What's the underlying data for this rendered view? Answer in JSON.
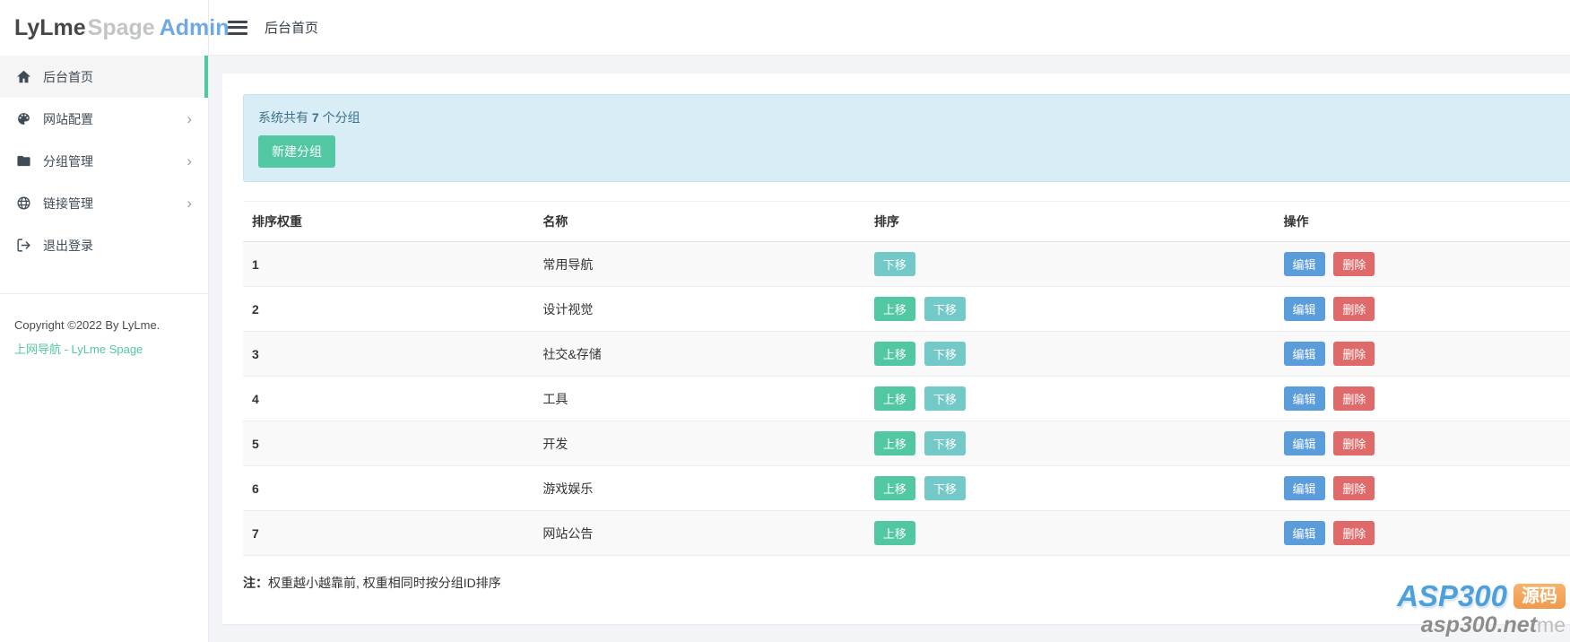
{
  "logo": {
    "part1": "LyLme",
    "part2": "Spage",
    "part3": "Admin"
  },
  "topbar": {
    "title": "后台首页"
  },
  "sidebar": {
    "items": [
      {
        "label": "后台首页"
      },
      {
        "label": "网站配置"
      },
      {
        "label": "分组管理"
      },
      {
        "label": "链接管理"
      },
      {
        "label": "退出登录"
      }
    ],
    "copyright": "Copyright ©2022 By LyLme.",
    "footer_link": "上网导航 - LyLme Spage"
  },
  "alert": {
    "text_prefix": "系统共有 ",
    "count": "7",
    "text_suffix": " 个分组",
    "button_label": "新建分组"
  },
  "table": {
    "headers": [
      "排序权重",
      "名称",
      "排序",
      "操作"
    ],
    "rows": [
      {
        "weight": "1",
        "name": "常用导航",
        "move_up": false,
        "move_down": true
      },
      {
        "weight": "2",
        "name": "设计视觉",
        "move_up": true,
        "move_down": true
      },
      {
        "weight": "3",
        "name": "社交&存储",
        "move_up": true,
        "move_down": true
      },
      {
        "weight": "4",
        "name": "工具",
        "move_up": true,
        "move_down": true
      },
      {
        "weight": "5",
        "name": "开发",
        "move_up": true,
        "move_down": true
      },
      {
        "weight": "6",
        "name": "游戏娱乐",
        "move_up": true,
        "move_down": true
      },
      {
        "weight": "7",
        "name": "网站公告",
        "move_up": true,
        "move_down": false
      }
    ],
    "buttons": {
      "up": "上移",
      "down": "下移",
      "edit": "编辑",
      "delete": "删除"
    },
    "note_label": "注：",
    "note_text": "权重越小越靠前, 权重相同时按分组ID排序"
  },
  "watermark": {
    "brand": "ASP300",
    "badge": "源码",
    "domain": "asp300.net",
    "suffix": "me"
  },
  "colors": {
    "accent_teal": "#52c7a3",
    "btn_down_cyan": "#72c9c8",
    "btn_edit_blue": "#5b9cdb",
    "btn_delete_red": "#e06a6a",
    "alert_bg": "#d9edf7",
    "alert_border": "#bfe3f1",
    "alert_text": "#3e7188",
    "logo_admin_blue": "#6fa9e2",
    "watermark_blue": "#4da0dc",
    "watermark_orange": "#f09a4d"
  }
}
